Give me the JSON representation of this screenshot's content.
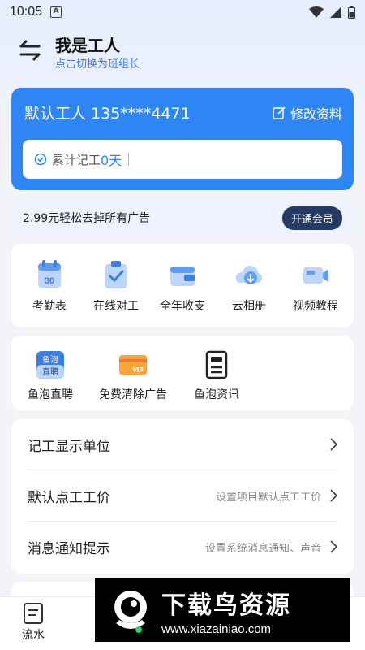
{
  "status_bar": {
    "time": "10:05",
    "a_badge": "A"
  },
  "header": {
    "title": "我是工人",
    "subtitle": "点击切换为班组长"
  },
  "profile": {
    "name": "默认工人 135****4471",
    "edit_label": "修改资料",
    "record_label": "累计记工",
    "record_days": "0天"
  },
  "ad_bar": {
    "text": "2.99元轻松去掉所有广告",
    "vip_button": "开通会员"
  },
  "tools": [
    {
      "label": "考勤表",
      "icon": "calendar-icon"
    },
    {
      "label": "在线对工",
      "icon": "clipboard-check-icon"
    },
    {
      "label": "全年收支",
      "icon": "wallet-icon"
    },
    {
      "label": "云相册",
      "icon": "cloud-download-icon"
    },
    {
      "label": "视频教程",
      "icon": "video-icon"
    }
  ],
  "services": [
    {
      "label": "鱼泡直聘",
      "icon": "yupao-zhipin-icon",
      "icon_text_1": "鱼泡",
      "icon_text_2": "直聘"
    },
    {
      "label": "免费清除广告",
      "icon": "vip-card-icon",
      "icon_text": "VIP"
    },
    {
      "label": "鱼泡资讯",
      "icon": "news-icon"
    }
  ],
  "settings": [
    {
      "label": "记工显示单位",
      "hint": ""
    },
    {
      "label": "默认点工工价",
      "hint": "设置项目默认点工工价"
    },
    {
      "label": "消息通知提示",
      "hint": "设置系统消息通知、声音"
    }
  ],
  "tabbar": {
    "tab1": "流水"
  },
  "watermark": {
    "title": "下载鸟资源",
    "url": "www.xiazainiao.com"
  },
  "colors": {
    "primary": "#2e86f5",
    "vip_button": "#253b66",
    "link": "#3e7bf2"
  }
}
